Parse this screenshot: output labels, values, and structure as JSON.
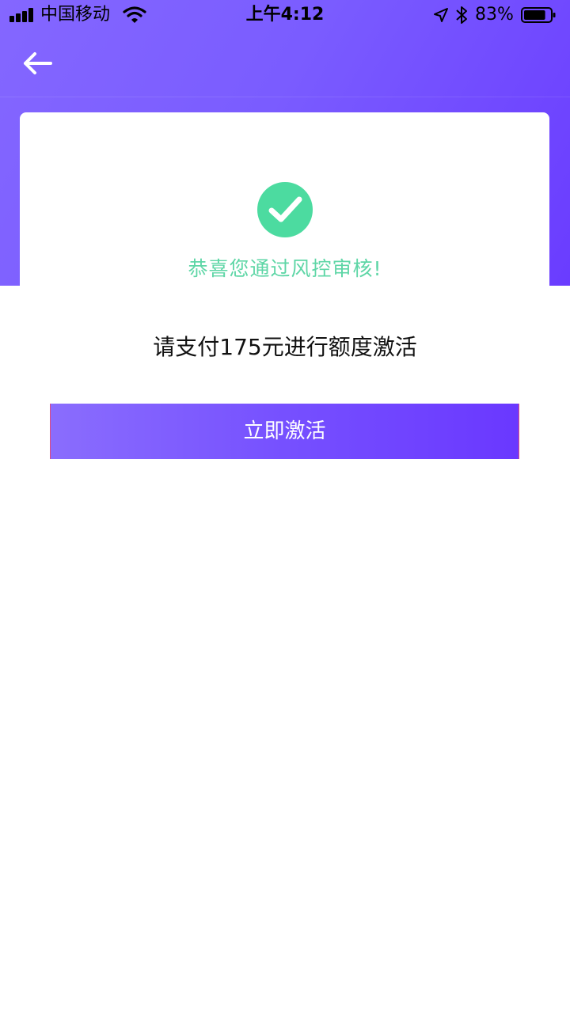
{
  "status_bar": {
    "carrier": "中国移动",
    "time": "上午4:12",
    "battery_percent": "83%",
    "battery_level": 0.83,
    "icons": [
      "signal-icon",
      "wifi-icon",
      "location-icon",
      "bluetooth-icon",
      "battery-icon"
    ]
  },
  "nav": {
    "back_icon": "arrow-left-icon"
  },
  "result": {
    "icon": "check-circle-icon",
    "message": "恭喜您通过风控审核!",
    "pay_prompt": "请支付175元进行额度激活"
  },
  "actions": {
    "activate_label": "立即激活"
  },
  "colors": {
    "header_start": "#8467ff",
    "header_end": "#6a3cff",
    "success_green": "#4cdba0",
    "success_text": "#5ed6a6",
    "button_start": "#8a6dfd",
    "button_end": "#6a38ff"
  }
}
